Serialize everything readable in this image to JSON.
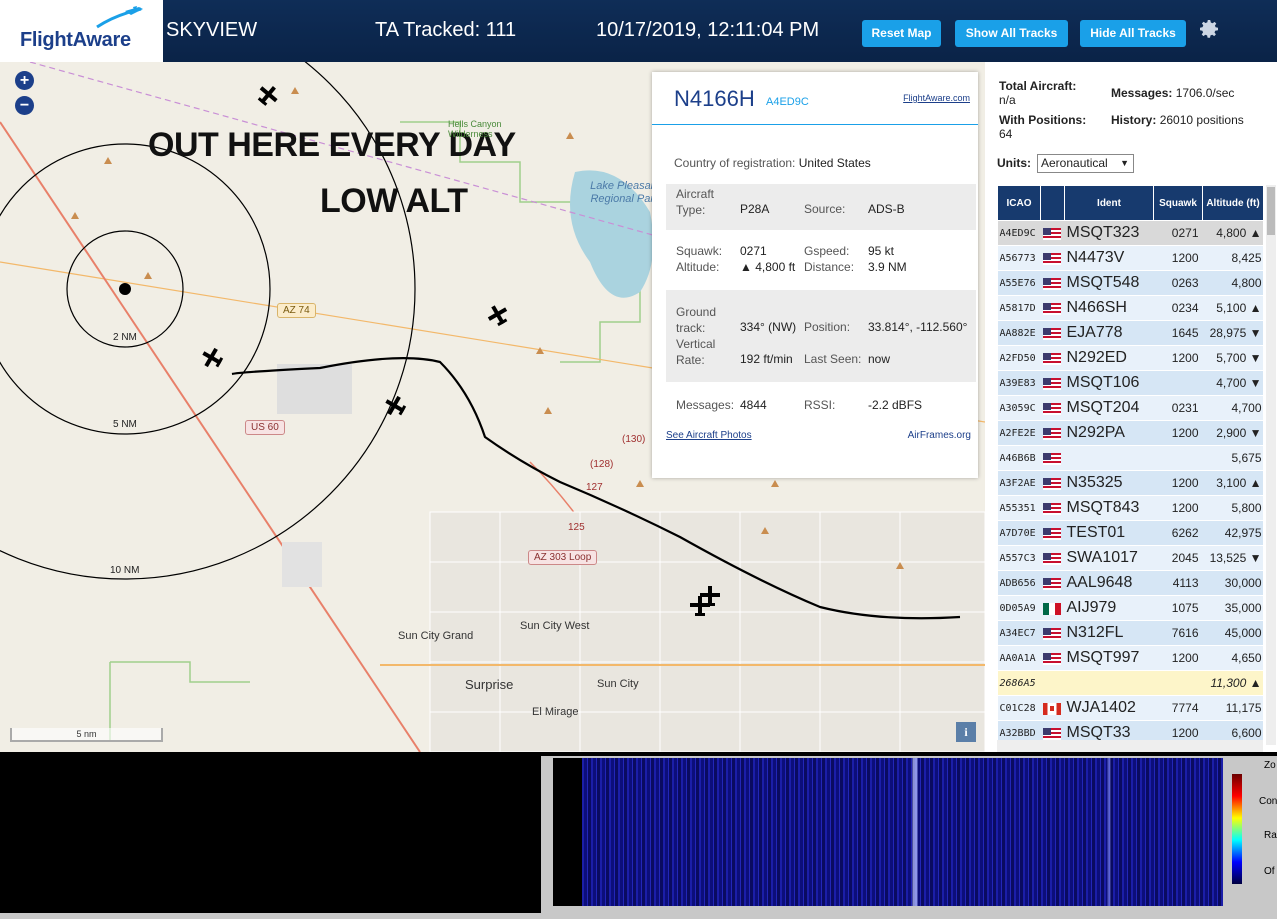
{
  "header": {
    "logo_text": "FlightAware",
    "app_title": "SKYVIEW",
    "tracked": "TA Tracked: 111",
    "clock": "10/17/2019, 12:11:04 PM",
    "buttons": {
      "reset": "Reset Map",
      "show_all": "Show All Tracks",
      "hide_all": "Hide All Tracks"
    },
    "settings_icon": "gear-icon"
  },
  "map": {
    "zoom_in": "+",
    "zoom_out": "−",
    "overlay": {
      "line1": "OUT HERE EVERY DAY",
      "line2": "LOW ALT"
    },
    "range_rings": [
      "2 NM",
      "5 NM",
      "10 NM"
    ],
    "places": {
      "sun_city_grand": "Sun City Grand",
      "sun_city_west": "Sun City West",
      "sun_city": "Sun City",
      "surprise": "Surprise",
      "el_mirage": "El Mirage",
      "lake_pleasant": "Lake Pleasant Regional Park",
      "hells_canyon": "Hells Canyon Wilderness"
    },
    "roads": {
      "az74": "AZ 74",
      "us60": "US 60",
      "az303": "AZ 303 Loop",
      "r130": "(130)",
      "r128": "(128)",
      "r127": "127",
      "r125": "125"
    },
    "scale_label": "5 nm",
    "info_button": "i"
  },
  "selected": {
    "callsign": "N4166H",
    "icao": "A4ED9C",
    "fa_link": "FlightAware.com",
    "country_label": "Country of registration:",
    "country": "United States",
    "aircraft_type_label": "Aircraft Type:",
    "aircraft_type": "P28A",
    "source_label": "Source:",
    "source": "ADS-B",
    "squawk_label": "Squawk:",
    "squawk": "0271",
    "gspeed_label": "Gspeed:",
    "gspeed": "95 kt",
    "altitude_label": "Altitude:",
    "altitude": "▲ 4,800 ft",
    "distance_label": "Distance:",
    "distance": "3.9 NM",
    "ground_track_label": "Ground track:",
    "ground_track": "334° (NW)",
    "position_label": "Position:",
    "position": "33.814°, -112.560°",
    "vertical_rate_label": "Vertical Rate:",
    "vertical_rate": "192 ft/min",
    "last_seen_label": "Last Seen:",
    "last_seen": "now",
    "messages_label": "Messages:",
    "messages": "4844",
    "rssi_label": "RSSI:",
    "rssi": "-2.2 dBFS",
    "photos_link": "See Aircraft Photos",
    "airframes_link": "AirFrames.org"
  },
  "stats": {
    "total_aircraft_label": "Total Aircraft:",
    "total_aircraft": "n/a",
    "messages_label": "Messages:",
    "messages": "1706.0/sec",
    "with_positions_label": "With Positions:",
    "with_positions": "64",
    "history_label": "History:",
    "history": "26010 positions",
    "units_label": "Units:",
    "units_value": "Aeronautical"
  },
  "table": {
    "headers": [
      "ICAO",
      "",
      "Ident",
      "Squawk",
      "Altitude (ft)"
    ],
    "rows": [
      {
        "icao": "A4ED9C",
        "flag": "us",
        "ident": "MSQT323",
        "squawk": "0271",
        "alt": "4,800 ▲",
        "state": "selected"
      },
      {
        "icao": "A56773",
        "flag": "us",
        "ident": "N4473V",
        "squawk": "1200",
        "alt": "8,425",
        "state": ""
      },
      {
        "icao": "A55E76",
        "flag": "us",
        "ident": "MSQT548",
        "squawk": "0263",
        "alt": "4,800",
        "state": ""
      },
      {
        "icao": "A5817D",
        "flag": "us",
        "ident": "N466SH",
        "squawk": "0234",
        "alt": "5,100 ▲",
        "state": ""
      },
      {
        "icao": "AA882E",
        "flag": "us",
        "ident": "EJA778",
        "squawk": "1645",
        "alt": "28,975 ▼",
        "state": ""
      },
      {
        "icao": "A2FD50",
        "flag": "us",
        "ident": "N292ED",
        "squawk": "1200",
        "alt": "5,700 ▼",
        "state": ""
      },
      {
        "icao": "A39E83",
        "flag": "us",
        "ident": "MSQT106",
        "squawk": "",
        "alt": "4,700 ▼",
        "state": ""
      },
      {
        "icao": "A3059C",
        "flag": "us",
        "ident": "MSQT204",
        "squawk": "0231",
        "alt": "4,700",
        "state": ""
      },
      {
        "icao": "A2FE2E",
        "flag": "us",
        "ident": "N292PA",
        "squawk": "1200",
        "alt": "2,900 ▼",
        "state": ""
      },
      {
        "icao": "A46B6B",
        "flag": "us",
        "ident": "",
        "squawk": "",
        "alt": "5,675",
        "state": ""
      },
      {
        "icao": "A3F2AE",
        "flag": "us",
        "ident": "N35325",
        "squawk": "1200",
        "alt": "3,100 ▲",
        "state": ""
      },
      {
        "icao": "A55351",
        "flag": "us",
        "ident": "MSQT843",
        "squawk": "1200",
        "alt": "5,800",
        "state": ""
      },
      {
        "icao": "A7D70E",
        "flag": "us",
        "ident": "TEST01",
        "squawk": "6262",
        "alt": "42,975",
        "state": ""
      },
      {
        "icao": "A557C3",
        "flag": "us",
        "ident": "SWA1017",
        "squawk": "2045",
        "alt": "13,525 ▼",
        "state": ""
      },
      {
        "icao": "ADB656",
        "flag": "us",
        "ident": "AAL9648",
        "squawk": "4113",
        "alt": "30,000",
        "state": ""
      },
      {
        "icao": "0D05A9",
        "flag": "mx",
        "ident": "AIJ979",
        "squawk": "1075",
        "alt": "35,000",
        "state": ""
      },
      {
        "icao": "A34EC7",
        "flag": "us",
        "ident": "N312FL",
        "squawk": "7616",
        "alt": "45,000",
        "state": ""
      },
      {
        "icao": "AA0A1A",
        "flag": "us",
        "ident": "MSQT997",
        "squawk": "1200",
        "alt": "4,650",
        "state": ""
      },
      {
        "icao": "2686A5",
        "flag": "",
        "ident": "",
        "squawk": "",
        "alt": "11,300 ▲",
        "state": "nopos"
      },
      {
        "icao": "C01C28",
        "flag": "ca",
        "ident": "WJA1402",
        "squawk": "7774",
        "alt": "11,175",
        "state": ""
      },
      {
        "icao": "A32BBD",
        "flag": "us",
        "ident": "MSQT33",
        "squawk": "1200",
        "alt": "6,600",
        "state": ""
      }
    ]
  },
  "waterfall": {
    "controls": [
      "Zo",
      "Con",
      "Ra",
      "Of"
    ]
  }
}
